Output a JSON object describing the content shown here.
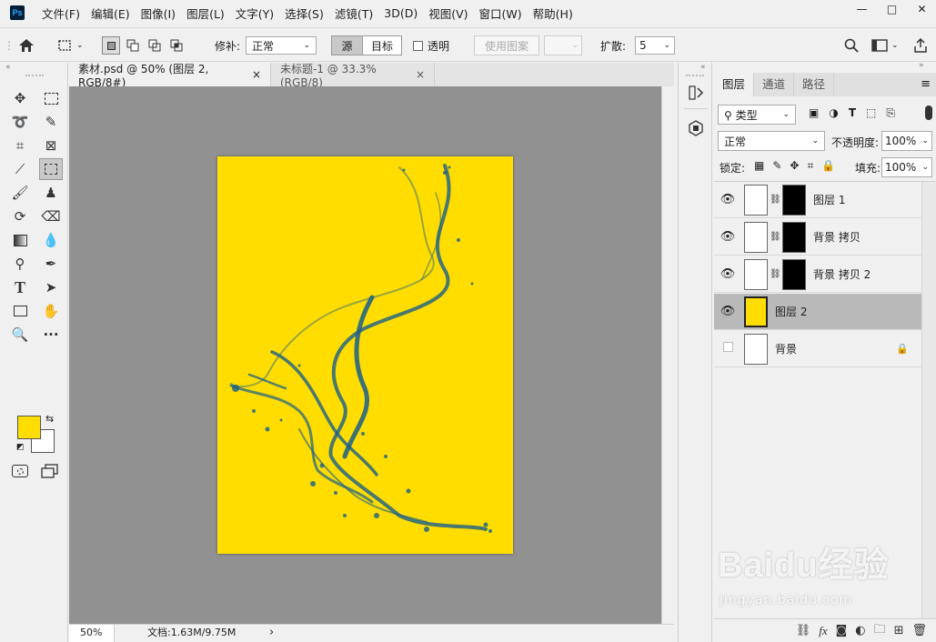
{
  "app": {
    "logo": "Ps"
  },
  "menu": [
    "文件(F)",
    "编辑(E)",
    "图像(I)",
    "图层(L)",
    "文字(Y)",
    "选择(S)",
    "滤镜(T)",
    "3D(D)",
    "视图(V)",
    "窗口(W)",
    "帮助(H)"
  ],
  "window_controls": {
    "minimize": "—",
    "maximize": "□",
    "close": "✕"
  },
  "options": {
    "patch_label": "修补:",
    "patch_mode": "正常",
    "source_btn": "源",
    "target_btn": "目标",
    "transparent_label": "透明",
    "use_pattern_btn": "使用图案",
    "diffusion_label": "扩散:",
    "diffusion_value": "5"
  },
  "tabs": [
    {
      "label": "素材.psd @ 50% (图层 2, RGB/8#)",
      "close": "×"
    },
    {
      "label": "未标题-1 @ 33.3%(RGB/8)",
      "close": "×"
    }
  ],
  "status": {
    "zoom": "50%",
    "doc": "文档:1.63M/9.75M",
    "arrow": "›"
  },
  "panel": {
    "tabs": [
      "图层",
      "通道",
      "路径"
    ],
    "filter_kind": "类型",
    "blend_mode": "正常",
    "opacity_label": "不透明度:",
    "opacity_value": "100%",
    "lock_label": "锁定:",
    "fill_label": "填充:",
    "fill_value": "100%",
    "layers": [
      {
        "name": "图层 1",
        "visible": true
      },
      {
        "name": "背景 拷贝",
        "visible": true
      },
      {
        "name": "背景 拷贝 2",
        "visible": true
      },
      {
        "name": "图层 2",
        "visible": true
      },
      {
        "name": "背景",
        "visible": false
      }
    ]
  },
  "watermark": {
    "brand": "Baidu经验",
    "url": "jingyan.baidu.com"
  },
  "colors": {
    "canvas_fill": "#ffdd00",
    "foreground": "#ffdd00",
    "background": "#ffffff",
    "splash": "#1a5f8a"
  }
}
